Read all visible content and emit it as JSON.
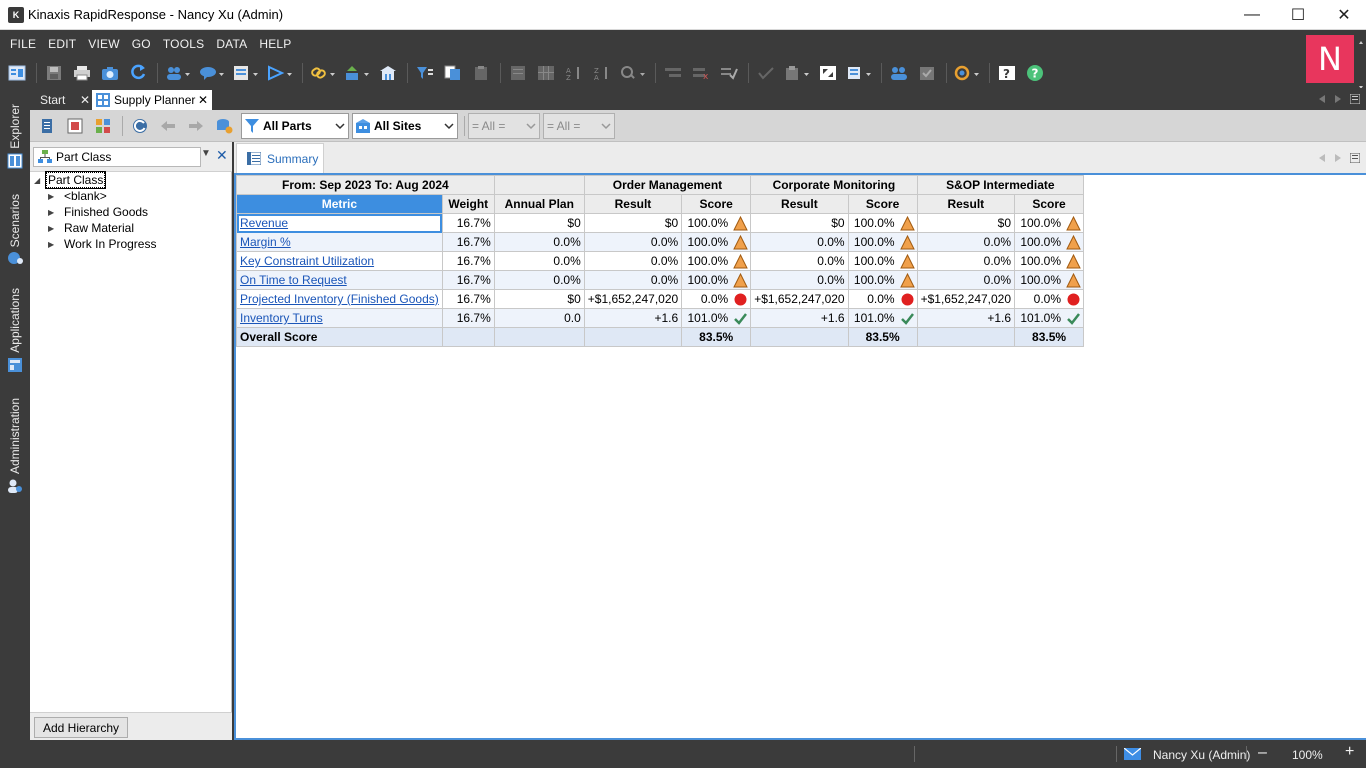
{
  "window": {
    "title": "Kinaxis RapidResponse - Nancy Xu (Admin)",
    "minimize": "—",
    "maximize": "☐",
    "close": "✕"
  },
  "menu": [
    "FILE",
    "EDIT",
    "VIEW",
    "GO",
    "TOOLS",
    "DATA",
    "HELP"
  ],
  "user_initial": "N",
  "leftnav": [
    "Explorer",
    "Scenarios",
    "Applications",
    "Administration"
  ],
  "tabs": {
    "start": "Start",
    "supply_planner": "Supply Planner"
  },
  "filters": {
    "parts": "All Parts",
    "sites": "All Sites",
    "filter3": "= All =",
    "filter4": "= All ="
  },
  "tree": {
    "hierarchy": "Part Class",
    "root": "Part Class",
    "items": [
      "<blank>",
      "Finished Goods",
      "Raw Material",
      "Work In Progress"
    ],
    "add_button": "Add Hierarchy"
  },
  "sheet_tab": "Summary",
  "grid": {
    "period": "From: Sep 2023   To: Aug 2024",
    "groups": [
      "Order Management",
      "Corporate Monitoring",
      "S&OP Intermediate"
    ],
    "col_metric": "Metric",
    "col_weight": "Weight",
    "col_plan": "Annual Plan",
    "col_result": "Result",
    "col_score": "Score",
    "rows": [
      {
        "metric": "Revenue",
        "weight": "16.7%",
        "plan": "$0",
        "r1": "$0",
        "s1": "100.0%",
        "r2": "$0",
        "s2": "100.0%",
        "r3": "$0",
        "s3": "100.0%",
        "status": "warning"
      },
      {
        "metric": "Margin %",
        "weight": "16.7%",
        "plan": "0.0%",
        "r1": "0.0%",
        "s1": "100.0%",
        "r2": "0.0%",
        "s2": "100.0%",
        "r3": "0.0%",
        "s3": "100.0%",
        "status": "warning"
      },
      {
        "metric": "Key Constraint Utilization",
        "weight": "16.7%",
        "plan": "0.0%",
        "r1": "0.0%",
        "s1": "100.0%",
        "r2": "0.0%",
        "s2": "100.0%",
        "r3": "0.0%",
        "s3": "100.0%",
        "status": "warning"
      },
      {
        "metric": "On Time to Request",
        "weight": "16.7%",
        "plan": "0.0%",
        "r1": "0.0%",
        "s1": "100.0%",
        "r2": "0.0%",
        "s2": "100.0%",
        "r3": "0.0%",
        "s3": "100.0%",
        "status": "warning"
      },
      {
        "metric": "Projected Inventory (Finished Goods)",
        "weight": "16.7%",
        "plan": "$0",
        "r1": "+$1,652,247,020",
        "s1": "0.0%",
        "r2": "+$1,652,247,020",
        "s2": "0.0%",
        "r3": "+$1,652,247,020",
        "s3": "0.0%",
        "status": "critical"
      },
      {
        "metric": "Inventory Turns",
        "weight": "16.7%",
        "plan": "0.0",
        "r1": "+1.6",
        "s1": "101.0%",
        "r2": "+1.6",
        "s2": "101.0%",
        "r3": "+1.6",
        "s3": "101.0%",
        "status": "ok"
      }
    ],
    "overall_label": "Overall Score",
    "overall": [
      "83.5%",
      "83.5%",
      "83.5%"
    ]
  },
  "status": {
    "user": "Nancy Xu (Admin)",
    "zoom": "100%",
    "minus": "–",
    "plus": "+"
  },
  "colors": {
    "accent": "#3d8ee0",
    "chrome": "#3b3b3b",
    "badge": "#e8365d",
    "warning": "#f0a04b",
    "critical": "#e02020",
    "ok": "#3a8a5a"
  }
}
